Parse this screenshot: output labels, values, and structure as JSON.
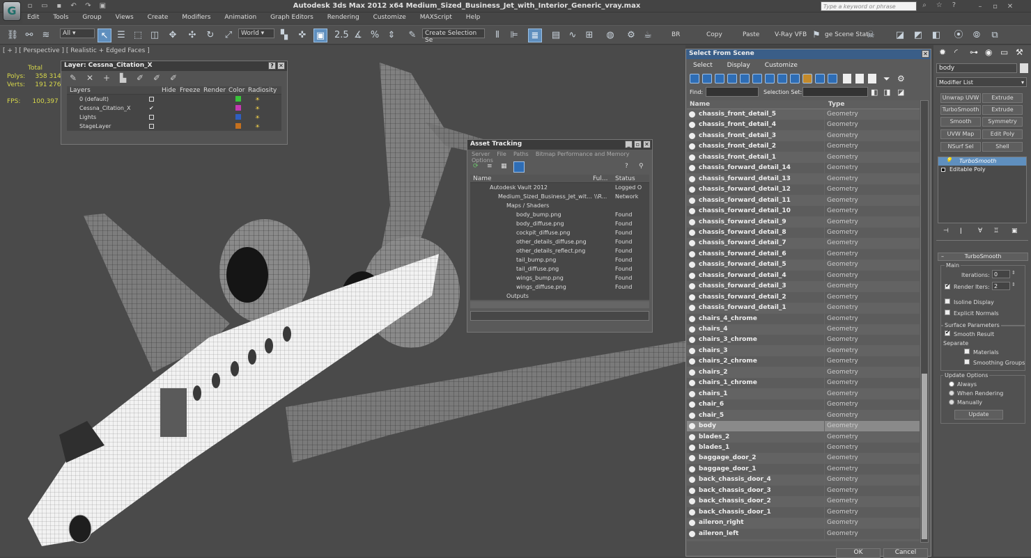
{
  "app": {
    "title": "Autodesk 3ds Max  2012 x64     Medium_Sized_Business_Jet_with_Interior_Generic_vray.max",
    "search_placeholder": "Type a keyword or phrase",
    "logo": "3ds-max-logo"
  },
  "menu": [
    "Edit",
    "Tools",
    "Group",
    "Views",
    "Create",
    "Modifiers",
    "Animation",
    "Graph Editors",
    "Rendering",
    "Customize",
    "MAXScript",
    "Help"
  ],
  "toolbar": {
    "filter_value": "All",
    "coord_value": "World",
    "selection_set_placeholder": "Create Selection Se",
    "labels": [
      "BR",
      "Copy",
      "Paste",
      "V-Ray VFB",
      "ge Scene Stat"
    ]
  },
  "viewport": {
    "label": "[ + ] [ Perspective ] [ Realistic + Edged Faces ]",
    "stats": {
      "total_label": "Total",
      "polys_label": "Polys:",
      "polys_value": "358 314",
      "verts_label": "Verts:",
      "verts_value": "191 276",
      "fps_label": "FPS:",
      "fps_value": "100,397"
    }
  },
  "layer_window": {
    "title": "Layer: Cessna_Citation_X",
    "columns": [
      "Layers",
      "Hide",
      "Freeze",
      "Render",
      "Color",
      "Radiosity"
    ],
    "rows": [
      {
        "name": "0 (default)",
        "color": "#39c43a"
      },
      {
        "name": "Cessna_Citation_X",
        "color": "#c43ab3"
      },
      {
        "name": "Lights",
        "color": "#2f5fc0"
      },
      {
        "name": "StageLayer",
        "color": "#c4701e"
      }
    ]
  },
  "asset_tracking": {
    "title": "Asset Tracking",
    "menu": [
      "Server",
      "File",
      "Paths",
      "Bitmap Performance and Memory",
      "Options"
    ],
    "columns": [
      "Name",
      "Ful...",
      "Status"
    ],
    "rows": [
      {
        "name": "Autodesk Vault 2012",
        "full": "",
        "status": "Logged O"
      },
      {
        "name": "Medium_Sized_Business_Jet_wit...",
        "full": "\\\\R...",
        "status": "Network"
      },
      {
        "name": "Maps / Shaders",
        "full": "",
        "status": ""
      },
      {
        "name": "body_bump.png",
        "full": "",
        "status": "Found"
      },
      {
        "name": "body_diffuse.png",
        "full": "",
        "status": "Found"
      },
      {
        "name": "cockpit_diffuse.png",
        "full": "",
        "status": "Found"
      },
      {
        "name": "other_details_diffuse.png",
        "full": "",
        "status": "Found"
      },
      {
        "name": "other_details_reflect.png",
        "full": "",
        "status": "Found"
      },
      {
        "name": "tail_bump.png",
        "full": "",
        "status": "Found"
      },
      {
        "name": "tail_diffuse.png",
        "full": "",
        "status": "Found"
      },
      {
        "name": "wings_bump.png",
        "full": "",
        "status": "Found"
      },
      {
        "name": "wings_diffuse.png",
        "full": "",
        "status": "Found"
      },
      {
        "name": "Outputs",
        "full": "",
        "status": ""
      }
    ]
  },
  "select_from_scene": {
    "title": "Select From Scene",
    "menu": [
      "Select",
      "Display",
      "Customize"
    ],
    "find_label": "Find:",
    "selection_set_label": "Selection Set:",
    "columns": [
      "Name",
      "Type"
    ],
    "selected": "body",
    "rows": [
      {
        "name": "chassis_front_detail_5",
        "type": "Geometry"
      },
      {
        "name": "chassis_front_detail_4",
        "type": "Geometry"
      },
      {
        "name": "chassis_front_detail_3",
        "type": "Geometry"
      },
      {
        "name": "chassis_front_detail_2",
        "type": "Geometry"
      },
      {
        "name": "chassis_front_detail_1",
        "type": "Geometry"
      },
      {
        "name": "chassis_forward_detail_14",
        "type": "Geometry"
      },
      {
        "name": "chassis_forward_detail_13",
        "type": "Geometry"
      },
      {
        "name": "chassis_forward_detail_12",
        "type": "Geometry"
      },
      {
        "name": "chassis_forward_detail_11",
        "type": "Geometry"
      },
      {
        "name": "chassis_forward_detail_10",
        "type": "Geometry"
      },
      {
        "name": "chassis_forward_detail_9",
        "type": "Geometry"
      },
      {
        "name": "chassis_forward_detail_8",
        "type": "Geometry"
      },
      {
        "name": "chassis_forward_detail_7",
        "type": "Geometry"
      },
      {
        "name": "chassis_forward_detail_6",
        "type": "Geometry"
      },
      {
        "name": "chassis_forward_detail_5",
        "type": "Geometry"
      },
      {
        "name": "chassis_forward_detail_4",
        "type": "Geometry"
      },
      {
        "name": "chassis_forward_detail_3",
        "type": "Geometry"
      },
      {
        "name": "chassis_forward_detail_2",
        "type": "Geometry"
      },
      {
        "name": "chassis_forward_detail_1",
        "type": "Geometry"
      },
      {
        "name": "chairs_4_chrome",
        "type": "Geometry"
      },
      {
        "name": "chairs_4",
        "type": "Geometry"
      },
      {
        "name": "chairs_3_chrome",
        "type": "Geometry"
      },
      {
        "name": "chairs_3",
        "type": "Geometry"
      },
      {
        "name": "chairs_2_chrome",
        "type": "Geometry"
      },
      {
        "name": "chairs_2",
        "type": "Geometry"
      },
      {
        "name": "chairs_1_chrome",
        "type": "Geometry"
      },
      {
        "name": "chairs_1",
        "type": "Geometry"
      },
      {
        "name": "chair_6",
        "type": "Geometry"
      },
      {
        "name": "chair_5",
        "type": "Geometry"
      },
      {
        "name": "body",
        "type": "Geometry"
      },
      {
        "name": "blades_2",
        "type": "Geometry"
      },
      {
        "name": "blades_1",
        "type": "Geometry"
      },
      {
        "name": "baggage_door_2",
        "type": "Geometry"
      },
      {
        "name": "baggage_door_1",
        "type": "Geometry"
      },
      {
        "name": "back_chassis_door_4",
        "type": "Geometry"
      },
      {
        "name": "back_chassis_door_3",
        "type": "Geometry"
      },
      {
        "name": "back_chassis_door_2",
        "type": "Geometry"
      },
      {
        "name": "back_chassis_door_1",
        "type": "Geometry"
      },
      {
        "name": "aileron_right",
        "type": "Geometry"
      },
      {
        "name": "aileron_left",
        "type": "Geometry"
      }
    ],
    "ok_label": "OK",
    "cancel_label": "Cancel"
  },
  "command_panel": {
    "object_name": "body",
    "modifier_list_label": "Modifier List",
    "modifier_buttons": [
      "Unwrap UVW",
      "Extrude",
      "TurboSmooth",
      "Extrude",
      "Smooth",
      "Symmetry",
      "UVW Map",
      "Edit Poly",
      "NSurf Sel",
      "Shell"
    ],
    "stack": [
      "TurboSmooth",
      "Editable Poly"
    ],
    "rollout_title": "TurboSmooth",
    "main_label": "Main",
    "iterations_label": "Iterations:",
    "iterations_value": "0",
    "render_iters_label": "Render Iters:",
    "render_iters_value": "2",
    "isoline_label": "Isoline Display",
    "explicit_normals_label": "Explicit Normals",
    "surface_params_label": "Surface Parameters",
    "smooth_result_label": "Smooth Result",
    "separate_label": "Separate",
    "materials_label": "Materials",
    "smoothing_groups_label": "Smoothing Groups",
    "update_options_label": "Update Options",
    "always_label": "Always",
    "when_rendering_label": "When Rendering",
    "manually_label": "Manually",
    "update_button": "Update"
  }
}
